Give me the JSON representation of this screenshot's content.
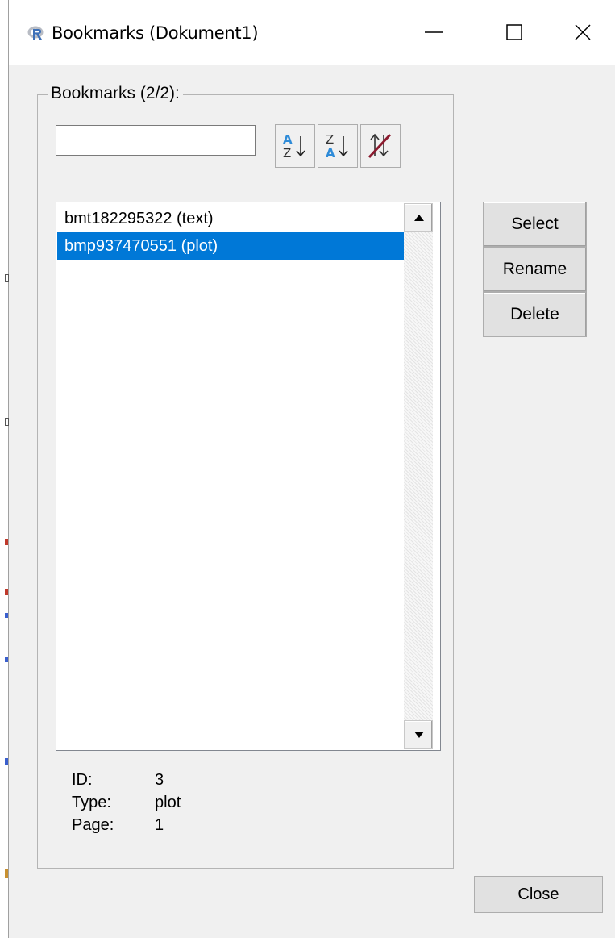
{
  "window": {
    "title": "Bookmarks (Dokument1)",
    "app_icon": "r-logo-icon",
    "controls": [
      "minimize-icon",
      "maximize-icon",
      "close-icon"
    ]
  },
  "group": {
    "label": "Bookmarks (2/2):"
  },
  "filter": {
    "value": "",
    "placeholder": ""
  },
  "sort_buttons": [
    {
      "icon": "sort-ascending-az-icon"
    },
    {
      "icon": "sort-descending-za-icon"
    },
    {
      "icon": "unsort-icon"
    }
  ],
  "bookmarks": {
    "items": [
      {
        "label": "bmt182295322 (text)",
        "selected": false
      },
      {
        "label": "bmp937470551 (plot)",
        "selected": true
      }
    ]
  },
  "details": {
    "id_label": "ID:",
    "id_value": "3",
    "type_label": "Type:",
    "type_value": "plot",
    "page_label": "Page:",
    "page_value": "1"
  },
  "actions": {
    "select": "Select",
    "rename": "Rename",
    "delete": "Delete"
  },
  "footer": {
    "close": "Close"
  },
  "colors": {
    "selection": "#0078d7",
    "dialog_bg": "#f0f0f0",
    "unsort_accent": "#8b1a2e",
    "sort_accent": "#2e8bd8"
  }
}
